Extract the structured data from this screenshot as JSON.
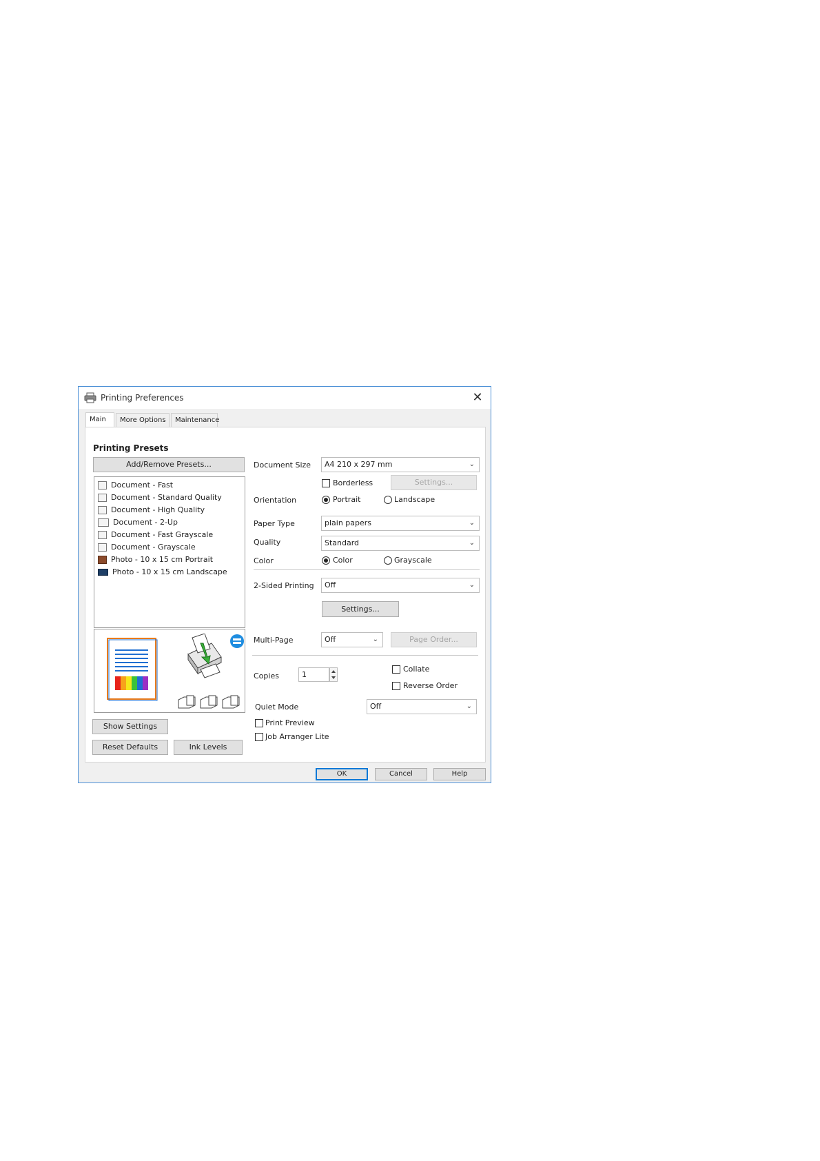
{
  "window": {
    "title": "Printing Preferences",
    "close_label": "✕"
  },
  "tabs": [
    {
      "label": "Main"
    },
    {
      "label": "More Options"
    },
    {
      "label": "Maintenance"
    }
  ],
  "presets": {
    "heading": "Printing Presets",
    "add_button": "Add/Remove Presets...",
    "items": [
      "Document - Fast",
      "Document - Standard Quality",
      "Document - High Quality",
      "Document - 2-Up",
      "Document - Fast Grayscale",
      "Document - Grayscale",
      "Photo - 10 x 15 cm Portrait",
      "Photo - 10 x 15 cm Landscape"
    ]
  },
  "left_buttons": {
    "show_settings": "Show Settings",
    "reset_defaults": "Reset Defaults",
    "ink_levels": "Ink Levels"
  },
  "form": {
    "document_size": {
      "label": "Document Size",
      "value": "A4 210 x 297 mm"
    },
    "borderless": {
      "label": "Borderless",
      "checked": false
    },
    "borderless_settings": "Settings...",
    "orientation": {
      "label": "Orientation",
      "portrait": "Portrait",
      "landscape": "Landscape",
      "selected": "Portrait"
    },
    "paper_type": {
      "label": "Paper Type",
      "value": "plain papers"
    },
    "quality": {
      "label": "Quality",
      "value": "Standard"
    },
    "color": {
      "label": "Color",
      "color": "Color",
      "grayscale": "Grayscale",
      "selected": "Color"
    },
    "two_sided": {
      "label": "2-Sided Printing",
      "value": "Off",
      "settings": "Settings..."
    },
    "multi_page": {
      "label": "Multi-Page",
      "value": "Off",
      "page_order": "Page Order..."
    },
    "copies": {
      "label": "Copies",
      "value": "1"
    },
    "collate": {
      "label": "Collate",
      "checked": false
    },
    "reverse_order": {
      "label": "Reverse Order",
      "checked": false
    },
    "quiet_mode": {
      "label": "Quiet Mode",
      "value": "Off"
    },
    "print_preview": {
      "label": "Print Preview",
      "checked": false
    },
    "job_arranger": {
      "label": "Job Arranger Lite",
      "checked": false
    }
  },
  "footer": {
    "ok": "OK",
    "cancel": "Cancel",
    "help": "Help"
  },
  "colors": {
    "window_border": "#4a8fd6",
    "ok_border": "#0078d7",
    "page_lines": "#1f6fd1",
    "page_border": "#e87a1a"
  }
}
